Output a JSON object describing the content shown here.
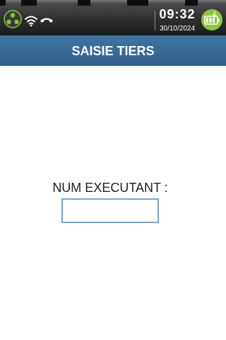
{
  "status_bar": {
    "time": "09:32",
    "date": "30/10/2024",
    "icons": [
      "network-icon",
      "wifi-icon",
      "phone-icon",
      "battery-charging-icon"
    ]
  },
  "header": {
    "title": "SAISIE TIERS"
  },
  "form": {
    "label": "NUM EXECUTANT :",
    "value": ""
  },
  "colors": {
    "header_bg": "#336699",
    "input_border": "#7aa3c6",
    "battery_green": "#8bc53f"
  }
}
